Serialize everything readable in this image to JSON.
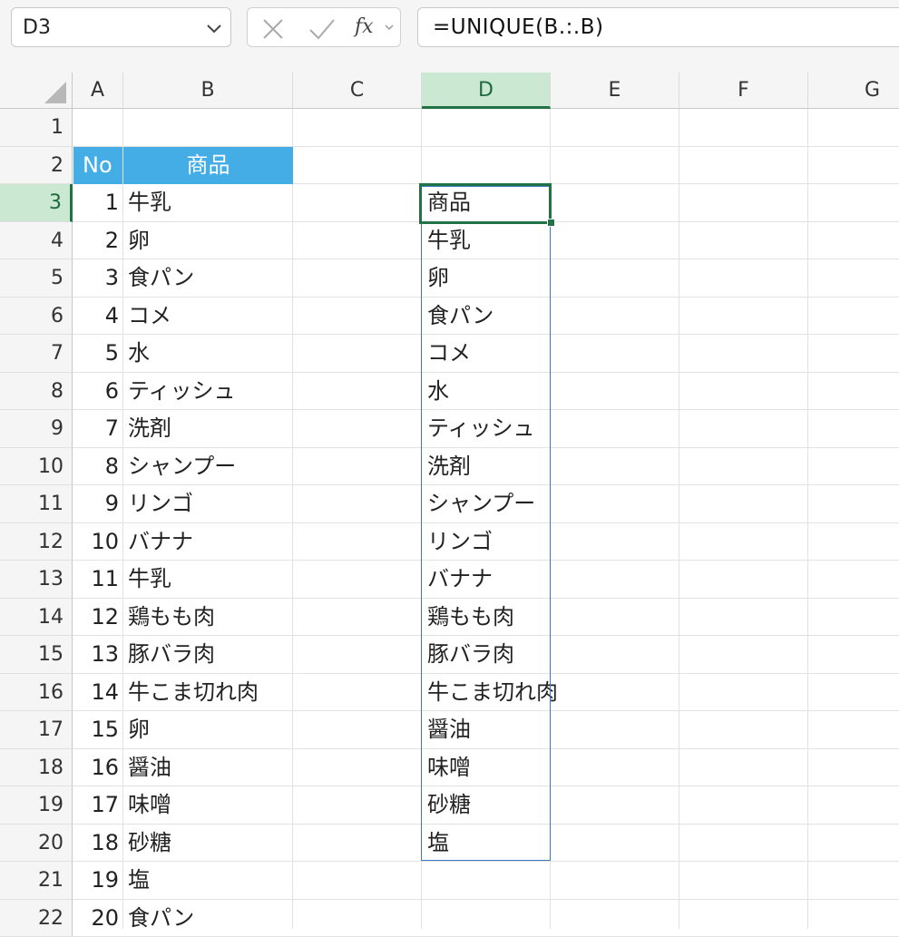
{
  "name_box": {
    "value": "D3"
  },
  "formula_bar": {
    "fx_label": "fx",
    "formula": "=UNIQUE(B.:.B)"
  },
  "columns": [
    "A",
    "B",
    "C",
    "D",
    "E",
    "F",
    "G"
  ],
  "selected_column": "D",
  "rows": [
    "1",
    "2",
    "3",
    "4",
    "5",
    "6",
    "7",
    "8",
    "9",
    "10",
    "11",
    "12",
    "13",
    "14",
    "15",
    "16",
    "17",
    "18",
    "19",
    "20",
    "21",
    "22"
  ],
  "selected_row": "3",
  "table_header": {
    "no": "No",
    "item": "商品"
  },
  "table_rows": [
    {
      "no": "1",
      "item": "牛乳"
    },
    {
      "no": "2",
      "item": "卵"
    },
    {
      "no": "3",
      "item": "食パン"
    },
    {
      "no": "4",
      "item": "コメ"
    },
    {
      "no": "5",
      "item": "水"
    },
    {
      "no": "6",
      "item": "ティッシュ"
    },
    {
      "no": "7",
      "item": "洗剤"
    },
    {
      "no": "8",
      "item": "シャンプー"
    },
    {
      "no": "9",
      "item": "リンゴ"
    },
    {
      "no": "10",
      "item": "バナナ"
    },
    {
      "no": "11",
      "item": "牛乳"
    },
    {
      "no": "12",
      "item": "鶏もも肉"
    },
    {
      "no": "13",
      "item": "豚バラ肉"
    },
    {
      "no": "14",
      "item": "牛こま切れ肉"
    },
    {
      "no": "15",
      "item": "卵"
    },
    {
      "no": "16",
      "item": "醤油"
    },
    {
      "no": "17",
      "item": "味噌"
    },
    {
      "no": "18",
      "item": "砂糖"
    },
    {
      "no": "19",
      "item": "塩"
    },
    {
      "no": "20",
      "item": "食パン"
    }
  ],
  "unique_results": [
    "商品",
    "牛乳",
    "卵",
    "食パン",
    "コメ",
    "水",
    "ティッシュ",
    "洗剤",
    "シャンプー",
    "リンゴ",
    "バナナ",
    "鶏もも肉",
    "豚バラ肉",
    "牛こま切れ肉",
    "醤油",
    "味噌",
    "砂糖",
    "塩"
  ],
  "colors": {
    "header_fill": "#45ade6",
    "selection_green": "#217346",
    "spill_border": "#3b78c4"
  }
}
